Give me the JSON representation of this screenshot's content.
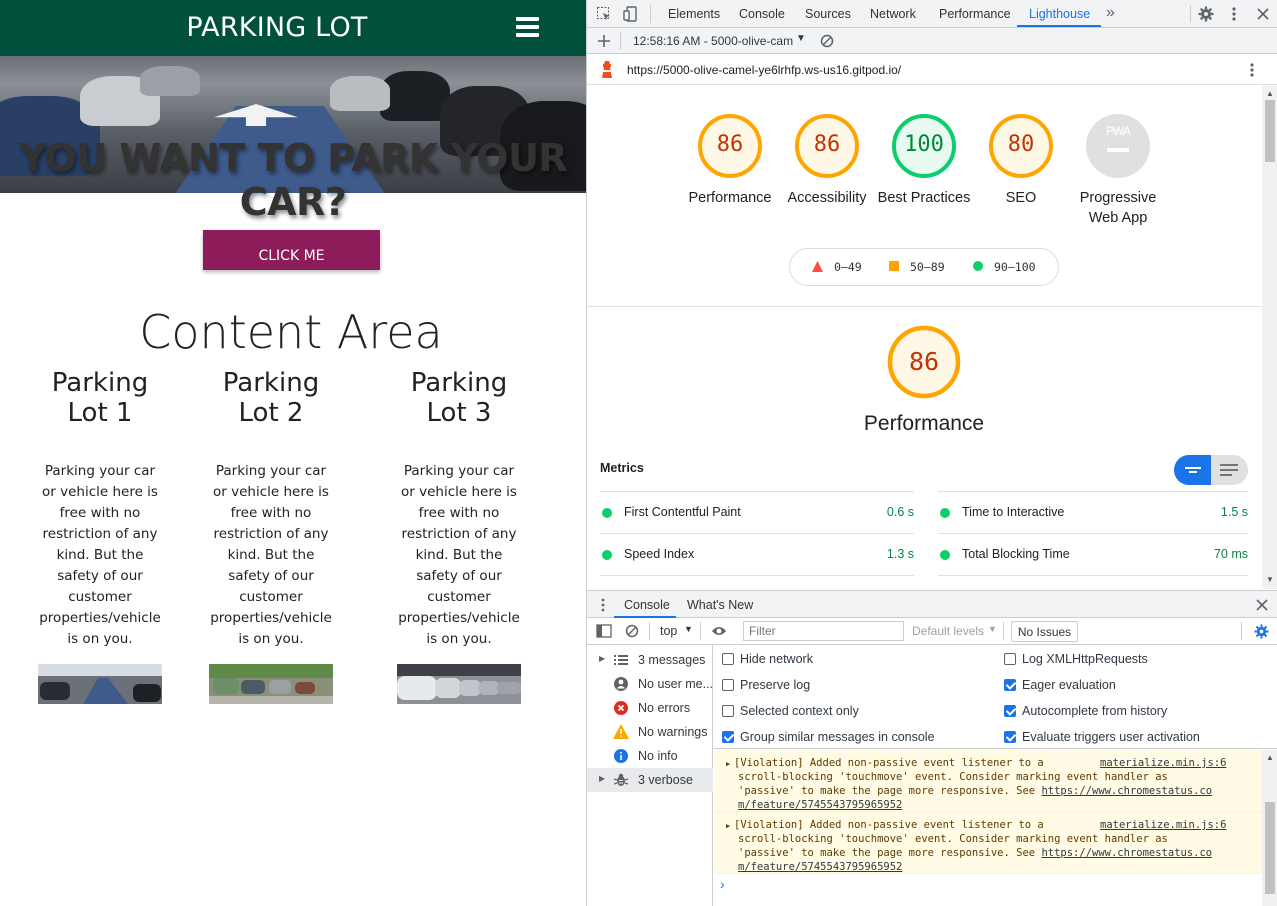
{
  "site": {
    "title": "PARKING LOT",
    "hero_heading": "YOU WANT TO PARK YOUR CAR?",
    "cta_label": "CLICK ME",
    "content_title": "Content Area",
    "lots": [
      {
        "title": "Parking Lot 1",
        "text": "Parking your car or vehicle here is free with no restriction of any kind. But the safety of our customer properties/vehicle is on you."
      },
      {
        "title": "Parking Lot 2",
        "text": "Parking your car or vehicle here is free with no restriction of any kind. But the safety of our customer properties/vehicle is on you."
      },
      {
        "title": "Parking Lot 3",
        "text": "Parking your car or vehicle here is free with no restriction of any kind. But the safety of our customer properties/vehicle is on you."
      }
    ],
    "colors": {
      "header": "#00503c",
      "cta": "#8c1d5a"
    }
  },
  "devtools": {
    "tabs": [
      "Elements",
      "Console",
      "Sources",
      "Network",
      "Performance",
      "Lighthouse"
    ],
    "active_tab": "Lighthouse",
    "more_tabs": "»",
    "report_selector": "12:58:16 AM - 5000-olive-cam",
    "url": "https://5000-olive-camel-ye6lrhfp.ws-us16.gitpod.io/",
    "scores": [
      {
        "value": "86",
        "label": "Performance",
        "color": "#ffa400"
      },
      {
        "value": "86",
        "label": "Accessibility",
        "color": "#ffa400"
      },
      {
        "value": "100",
        "label": "Best Practices",
        "color": "#0cce6b"
      },
      {
        "value": "80",
        "label": "SEO",
        "color": "#ffa400"
      },
      {
        "value": "PWA",
        "label": "Progressive Web App",
        "color": "#9e9e9e"
      }
    ],
    "legend": [
      {
        "range": "0–49",
        "color": "#ff4e42"
      },
      {
        "range": "50–89",
        "color": "#ffa400"
      },
      {
        "range": "90–100",
        "color": "#0cce6b"
      }
    ],
    "perf_score": "86",
    "perf_title": "Performance",
    "metrics_title": "Metrics",
    "metrics": [
      {
        "name": "First Contentful Paint",
        "value": "0.6 s"
      },
      {
        "name": "Time to Interactive",
        "value": "1.5 s"
      },
      {
        "name": "Speed Index",
        "value": "1.3 s"
      },
      {
        "name": "Total Blocking Time",
        "value": "70 ms"
      }
    ],
    "drawer_tabs": [
      "Console",
      "What's New"
    ],
    "console": {
      "context": "top",
      "filter_placeholder": "Filter",
      "levels": "Default levels",
      "issues": "No Issues",
      "sidebar": [
        {
          "label": "3 messages",
          "icon": "list-icon"
        },
        {
          "label": "No user me...",
          "icon": "user-icon"
        },
        {
          "label": "No errors",
          "icon": "error-icon"
        },
        {
          "label": "No warnings",
          "icon": "warning-icon"
        },
        {
          "label": "No info",
          "icon": "info-icon"
        },
        {
          "label": "3 verbose",
          "icon": "bug-icon"
        }
      ],
      "settings_left": [
        {
          "label": "Hide network",
          "checked": false
        },
        {
          "label": "Preserve log",
          "checked": false
        },
        {
          "label": "Selected context only",
          "checked": false
        },
        {
          "label": "Group similar messages in console",
          "checked": true
        }
      ],
      "settings_right": [
        {
          "label": "Log XMLHttpRequests",
          "checked": false
        },
        {
          "label": "Eager evaluation",
          "checked": true
        },
        {
          "label": "Autocomplete from history",
          "checked": true
        },
        {
          "label": "Evaluate triggers user activation",
          "checked": true
        }
      ],
      "messages": [
        {
          "l1": "[Violation] Added non-passive event listener to a",
          "src": "materialize.min.js:6",
          "l2": "scroll-blocking 'touchmove' event. Consider marking event handler as",
          "l3": "'passive' to make the page more responsive. See ",
          "link1": "https://www.chromestatus.co",
          "link2": "m/feature/5745543795965952"
        },
        {
          "l1": "[Violation] Added non-passive event listener to a",
          "src": "materialize.min.js:6",
          "l2": "scroll-blocking 'touchmove' event. Consider marking event handler as",
          "l3": "'passive' to make the page more responsive. See ",
          "link1": "https://www.chromestatus.co",
          "link2": "m/feature/5745543795965952"
        }
      ],
      "prompt": "›"
    }
  }
}
